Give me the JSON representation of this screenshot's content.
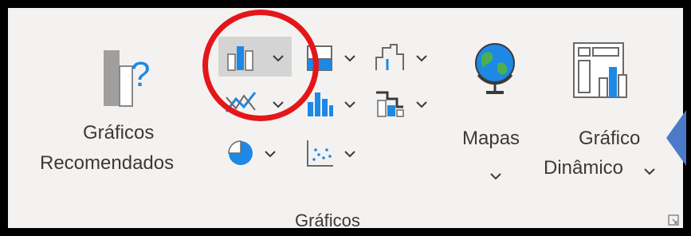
{
  "ribbon_group": {
    "name": "Gráficos",
    "recommended": {
      "line1": "Gráficos",
      "line2": "Recomendados"
    },
    "maps": {
      "label": "Mapas"
    },
    "pivot": {
      "line1": "Gráfico",
      "line2": "Dinâmico"
    }
  },
  "chart_buttons": [
    {
      "id": "column-bar",
      "icon": "column-chart-icon",
      "selected": true
    },
    {
      "id": "hierarchy",
      "icon": "hierarchy-chart-icon"
    },
    {
      "id": "statistic",
      "icon": "statistic-chart-icon"
    },
    {
      "id": "line-area",
      "icon": "line-chart-icon"
    },
    {
      "id": "waterfall",
      "icon": "waterfall-chart-icon"
    },
    {
      "id": "combo",
      "icon": "combo-chart-icon"
    },
    {
      "id": "pie-donut",
      "icon": "pie-chart-icon"
    },
    {
      "id": "scatter",
      "icon": "scatter-chart-icon"
    }
  ],
  "colors": {
    "accent_blue": "#1e88e5",
    "gray_icon": "#8a8886",
    "highlight_circle": "#e3171a",
    "selected_bg": "#d4d4d4"
  }
}
